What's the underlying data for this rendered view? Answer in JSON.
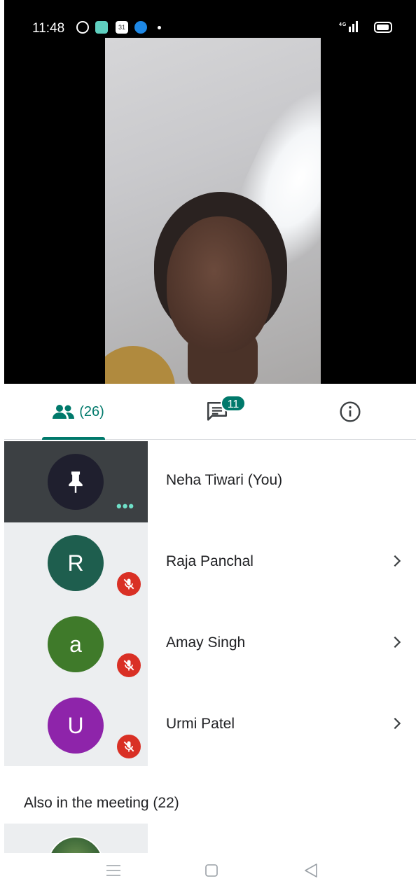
{
  "status_bar": {
    "time": "11:48",
    "icons": [
      "whatsapp-icon",
      "app-icon",
      "calendar-icon",
      "app-o-icon",
      "notification-dot"
    ],
    "calendar_day": "31",
    "signal_text": "⁴ᴳ |||",
    "battery": "battery-icon"
  },
  "tabs": {
    "people_count": "(26)",
    "chat_badge": "11",
    "icons": [
      "people-icon",
      "chat-icon",
      "info-icon"
    ],
    "accent_color": "#00796b"
  },
  "participants": [
    {
      "name": "Neha Tiwari (You)",
      "avatar_type": "pin",
      "avatar_color": "#1f1f2e",
      "self": true
    },
    {
      "name": "Raja Panchal",
      "initial": "R",
      "avatar_color": "#1e5e4e",
      "muted": true
    },
    {
      "name": "Amay Singh",
      "initial": "a",
      "avatar_color": "#3f7a2a",
      "muted": true
    },
    {
      "name": "Urmi Patel",
      "initial": "U",
      "avatar_color": "#8e24aa",
      "muted": true
    }
  ],
  "also_in_meeting": "Also in the meeting (22)",
  "nav": {
    "icons": [
      "recents-icon",
      "home-icon",
      "back-icon"
    ]
  }
}
